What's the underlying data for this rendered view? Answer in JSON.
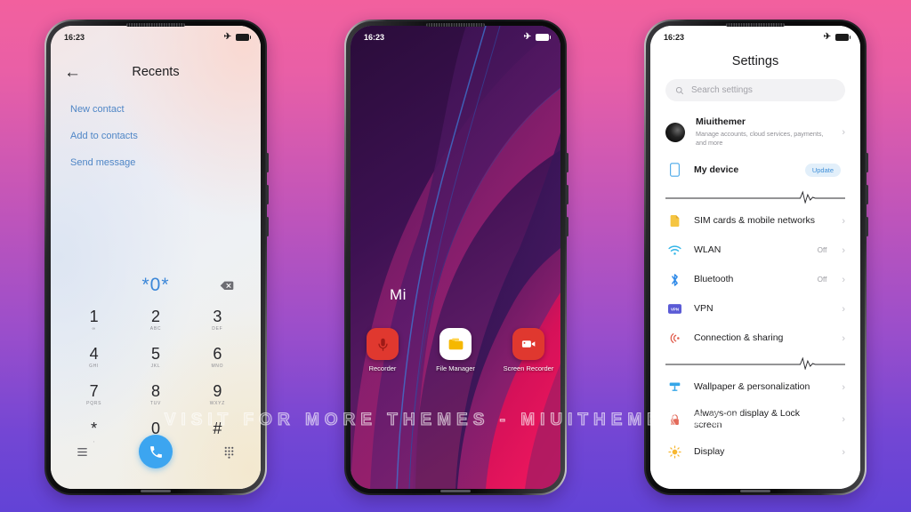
{
  "background": {
    "top_color": "#f2609e",
    "bottom_color": "#6243d6"
  },
  "watermark": {
    "text": "VISIT FOR MORE THEMES - MIUITHEMER.COM"
  },
  "phone_dialer": {
    "status_bar": {
      "time": "16:23",
      "airplane_icon": "airplane-icon",
      "battery_icon": "battery-icon"
    },
    "back_icon": "back-arrow-icon",
    "title": "Recents",
    "links": [
      {
        "label": "New contact"
      },
      {
        "label": "Add to contacts"
      },
      {
        "label": "Send message"
      }
    ],
    "dialed_number": "*0*",
    "delete_icon": "backspace-icon",
    "accent_color": "#3c87d8",
    "keys": [
      {
        "number": "1",
        "letters": "∞"
      },
      {
        "number": "2",
        "letters": "ABC"
      },
      {
        "number": "3",
        "letters": "DEF"
      },
      {
        "number": "4",
        "letters": "GHI"
      },
      {
        "number": "5",
        "letters": "JKL"
      },
      {
        "number": "6",
        "letters": "MNO"
      },
      {
        "number": "7",
        "letters": "PQRS"
      },
      {
        "number": "8",
        "letters": "TUV"
      },
      {
        "number": "9",
        "letters": "WXYZ"
      },
      {
        "number": "*",
        "letters": ","
      },
      {
        "number": "0",
        "letters": "+"
      },
      {
        "number": "#",
        "letters": ""
      }
    ],
    "bottom_bar": {
      "menu_icon": "hamburger-menu-icon",
      "call_icon": "phone-call-icon",
      "call_button_color": "#3ca5f0",
      "keypad_icon": "dialpad-icon"
    }
  },
  "phone_home": {
    "status_bar": {
      "time": "16:23",
      "airplane_icon": "airplane-icon",
      "battery_icon": "battery-icon"
    },
    "widget_label": "Mi",
    "apps": [
      {
        "name": "Recorder",
        "icon": "microphone-icon",
        "bg": "#e0382f"
      },
      {
        "name": "File Manager",
        "icon": "folder-icon",
        "bg": "#ffffff"
      },
      {
        "name": "Screen Recorder",
        "icon": "camcorder-icon",
        "bg": "#e0382f"
      }
    ]
  },
  "phone_settings": {
    "status_bar": {
      "time": "16:23",
      "airplane_icon": "airplane-icon",
      "battery_icon": "battery-icon"
    },
    "title": "Settings",
    "search": {
      "placeholder": "Search settings",
      "icon": "search-icon"
    },
    "account": {
      "name": "Miuithemer",
      "subtitle": "Manage accounts, cloud services, payments, and more",
      "avatar_icon": "avatar-icon"
    },
    "rows": [
      {
        "label": "My device",
        "icon": "device-icon",
        "icon_color": "#4aa8e8",
        "badge": "Update",
        "value": ""
      },
      {
        "label": "SIM cards & mobile networks",
        "icon": "sim-card-icon",
        "icon_color": "#f5c542",
        "value": ""
      },
      {
        "label": "WLAN",
        "icon": "wifi-icon",
        "icon_color": "#35b6e8",
        "value": "Off"
      },
      {
        "label": "Bluetooth",
        "icon": "bluetooth-icon",
        "icon_color": "#2f8ae8",
        "value": "Off"
      },
      {
        "label": "VPN",
        "icon": "vpn-icon",
        "icon_color": "#5b5bd6",
        "value": ""
      },
      {
        "label": "Connection & sharing",
        "icon": "connection-sharing-icon",
        "icon_color": "#e05a4a",
        "value": ""
      },
      {
        "label": "Wallpaper & personalization",
        "icon": "wallpaper-icon",
        "icon_color": "#35a6e8",
        "value": ""
      },
      {
        "label": "Always-on display & Lock screen",
        "icon": "lock-icon",
        "icon_color": "#e36a5a",
        "value": ""
      },
      {
        "label": "Display",
        "icon": "brightness-icon",
        "icon_color": "#f7b731",
        "value": ""
      }
    ],
    "chevron_icon": "chevron-right-icon",
    "divider_icon": "heartbeat-divider-icon"
  }
}
